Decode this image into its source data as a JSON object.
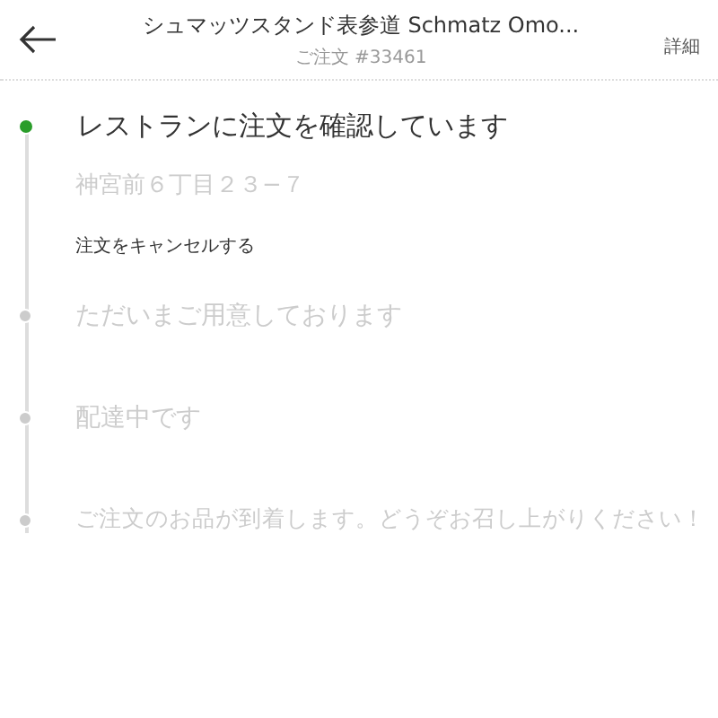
{
  "header": {
    "title": "シュマッツスタンド表参道 Schmatz Omo...",
    "subtitle": "ご注文 #33461",
    "details_button": "詳細"
  },
  "steps": [
    {
      "label": "レストランに注文を確認しています",
      "active": true,
      "address": "神宮前６丁目２３−７",
      "cancel_link": "注文をキャンセルする"
    },
    {
      "label": "ただいまご用意しております",
      "active": false
    },
    {
      "label": "配達中です",
      "active": false
    },
    {
      "label": "ご注文のお品が到着します。どうぞお召し上がりください！",
      "active": false
    }
  ]
}
